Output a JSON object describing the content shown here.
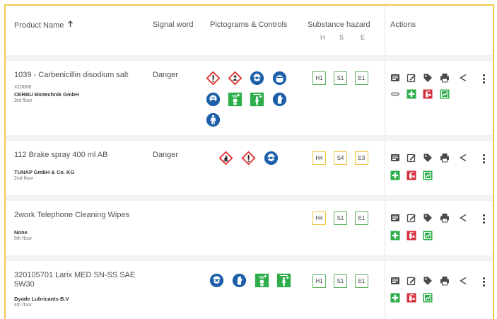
{
  "header": {
    "product_name": "Product Name",
    "sort_icon": "arrow-up-icon",
    "signal_word": "Signal word",
    "pictograms": "Pictograms & Controls",
    "substance_hazard": "Substance hazard",
    "h": "H",
    "s": "S",
    "e": "E",
    "actions": "Actions"
  },
  "colors": {
    "accent_border": "#f3c94a",
    "hazard_red": "#e23a3a",
    "ppe_blue": "#1c5ea8",
    "first_aid_green": "#2eae4b",
    "fire_red": "#d62d3c",
    "box_green": "#5fb25f",
    "box_yellow": "#f0c43a"
  },
  "rows": [
    {
      "name": "1039 - Carbenicillin disodium salt",
      "code": "X10008",
      "company": "CERBU Biotechnik GmbH",
      "location": "3rd floor",
      "signal": "Danger",
      "pictograms": [
        "exclamation-ghs-icon",
        "environment-ghs-icon",
        "goggles-ppe-icon",
        "face-shield-ppe-icon",
        "respirator-ppe-icon",
        "eyewash-icon",
        "safety-shower-icon",
        "gloves-ppe-icon",
        "protective-clothing-ppe-icon"
      ],
      "h": "H1",
      "s": "S1",
      "e": "E1",
      "h_level": "green",
      "s_level": "green",
      "e_level": "green",
      "actions": [
        "sds-icon",
        "edit-icon",
        "tag-icon",
        "print-icon",
        "share-icon",
        "more-icon",
        "link-icon",
        "first-aid-icon",
        "fire-extinguisher-icon",
        "emergency-exit-icon"
      ]
    },
    {
      "name": "112 Brake spray 400 ml AB",
      "code": "",
      "company": "TUNAP GmbH & Co. KG",
      "location": "2nd floor",
      "signal": "Danger",
      "pictograms": [
        "flammable-ghs-icon",
        "exclamation-ghs-icon",
        "goggles-ppe-icon"
      ],
      "h": "H4",
      "s": "S4",
      "e": "E3",
      "h_level": "yellow",
      "s_level": "yellow",
      "e_level": "yellow",
      "actions": [
        "sds-icon",
        "edit-icon",
        "tag-icon",
        "print-icon",
        "share-icon",
        "more-icon",
        "first-aid-icon",
        "fire-extinguisher-icon",
        "emergency-exit-icon"
      ]
    },
    {
      "name": "2work Telephone Cleaning Wipes",
      "code": "",
      "company": "None",
      "location": "5th floor",
      "signal": "",
      "pictograms": [],
      "h": "H4",
      "s": "S1",
      "e": "E1",
      "h_level": "yellow",
      "s_level": "green",
      "e_level": "green",
      "actions": [
        "sds-icon",
        "edit-icon",
        "tag-icon",
        "print-icon",
        "share-icon",
        "more-icon",
        "first-aid-icon",
        "fire-extinguisher-icon",
        "emergency-exit-icon"
      ]
    },
    {
      "name": "320105701 Larix MED SN-SS SAE 5W30",
      "code": "",
      "company": "Dyade Lubricants B.V",
      "location": "4th floor",
      "signal": "",
      "pictograms": [
        "goggles-ppe-icon",
        "gloves-ppe-icon",
        "eyewash-icon",
        "safety-shower-icon"
      ],
      "h": "H1",
      "s": "S1",
      "e": "E1",
      "h_level": "green",
      "s_level": "green",
      "e_level": "green",
      "actions": [
        "sds-icon",
        "edit-icon",
        "tag-icon",
        "print-icon",
        "share-icon",
        "more-icon",
        "first-aid-icon",
        "fire-extinguisher-icon",
        "emergency-exit-icon"
      ]
    }
  ]
}
